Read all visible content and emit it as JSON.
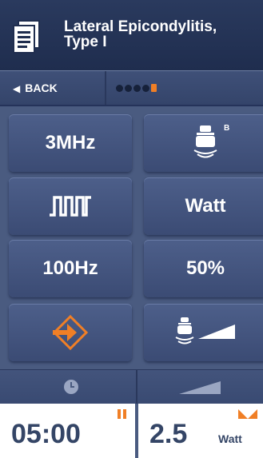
{
  "header": {
    "title_line1": "Lateral Epicondylitis,",
    "title_line2": "Type I",
    "icon": "document-icon"
  },
  "nav": {
    "back_label": "BACK",
    "progress": {
      "steps": 5,
      "current": 5
    }
  },
  "buttons": {
    "frequency": "3MHz",
    "head_badge": "B",
    "waveform_icon": "pulse-wave-icon",
    "power_unit": "Watt",
    "pulse_freq": "100Hz",
    "duty_cycle": "50%",
    "enter_icon": "enter-icon",
    "head_ramp_icon": "head-intensity-icon"
  },
  "footer": {
    "timer_icon": "clock-icon",
    "intensity_icon": "ramp-icon",
    "time_value": "05:00",
    "intensity_value": "2.5",
    "intensity_unit": "Watt"
  },
  "colors": {
    "background": "#4a5b80",
    "header": "#22325a",
    "accent": "#f07f26",
    "value_text": "#344566"
  }
}
